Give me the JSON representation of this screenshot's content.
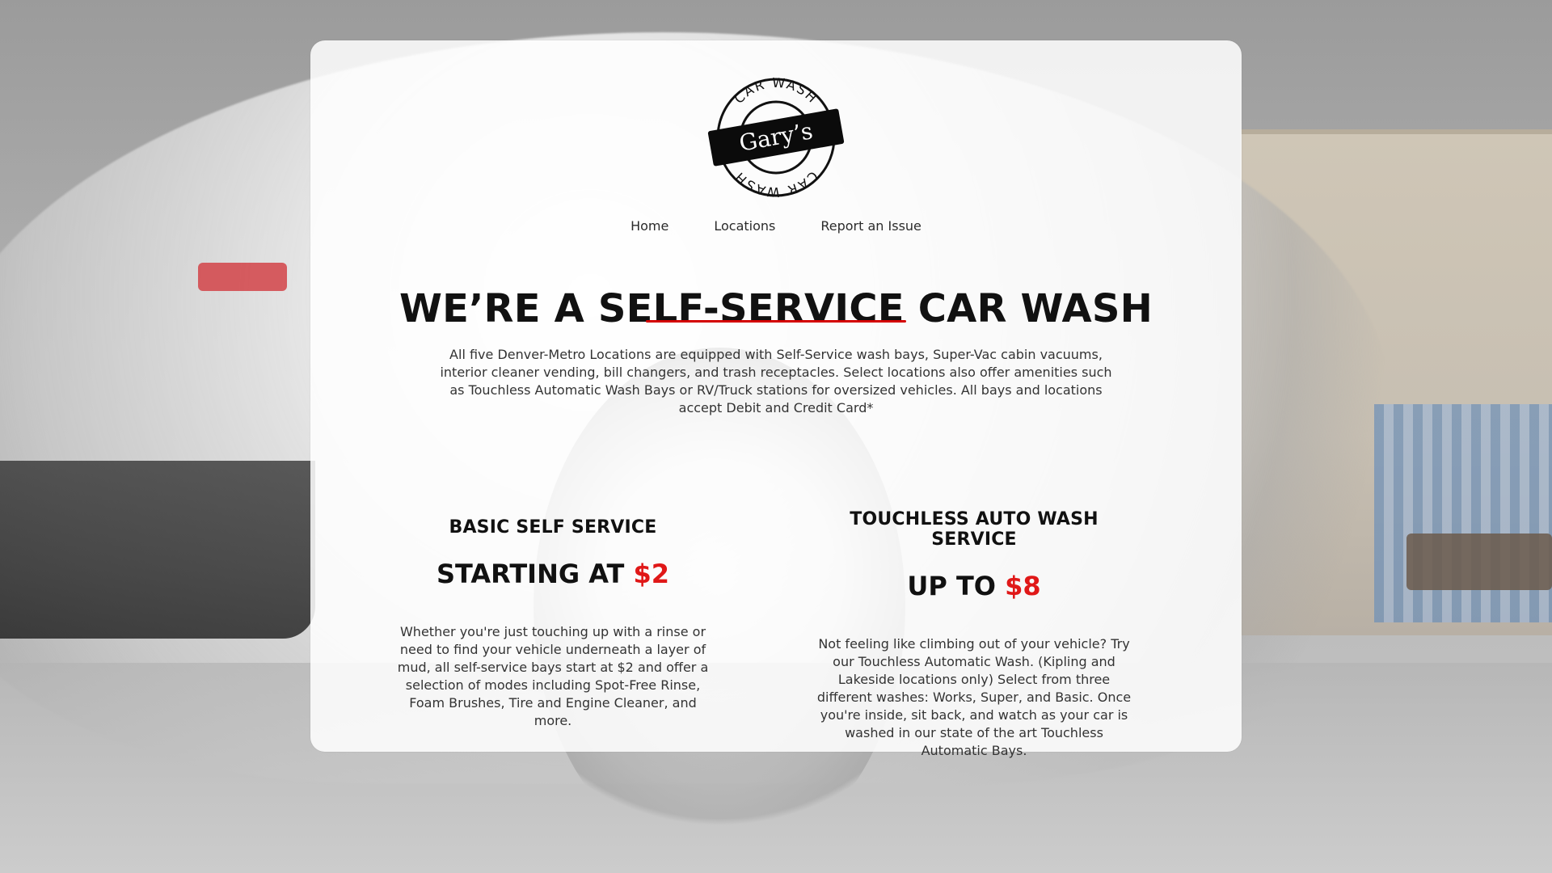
{
  "brand": {
    "name": "Gary’s",
    "ring_text_top": "CAR WASH",
    "ring_text_bottom": "CAR WASH"
  },
  "nav": {
    "items": [
      {
        "label": "Home"
      },
      {
        "label": "Locations"
      },
      {
        "label": "Report an Issue"
      }
    ]
  },
  "hero": {
    "headline": "WE’RE A SELF-SERVICE CAR WASH",
    "intro": "All five Denver-Metro Locations are equipped with Self-Service wash bays, Super-Vac cabin vacuums, interior cleaner vending, bill changers, and trash receptacles. Select locations also offer amenities such as Touchless Automatic Wash Bays or RV/Truck stations for oversized vehicles. All bays and locations accept Debit and Credit Card*"
  },
  "services": [
    {
      "title": "BASIC SELF SERVICE",
      "price_prefix": "STARTING AT",
      "price_amount": "$2",
      "description": "Whether you're just touching up with a rinse or need to find your vehicle underneath a layer of mud, all self-service bays start at $2 and offer a selection of modes including Spot-Free Rinse, Foam Brushes, Tire and Engine Cleaner, and more."
    },
    {
      "title": "TOUCHLESS AUTO WASH SERVICE",
      "price_prefix": "UP TO",
      "price_amount": "$8",
      "description": "Not feeling like climbing out of your vehicle? Try our Touchless Automatic Wash. (Kipling and Lakeside locations only) Select from three different washes: Works, Super, and Basic. Once you're inside, sit back, and watch as your car is washed in our state of the art Touchless Automatic Bays."
    }
  ],
  "colors": {
    "accent_red": "#e01818",
    "underline_red": "#d40000",
    "text_dark": "#111111",
    "text_body": "#333333",
    "card_bg": "#ffffff"
  }
}
